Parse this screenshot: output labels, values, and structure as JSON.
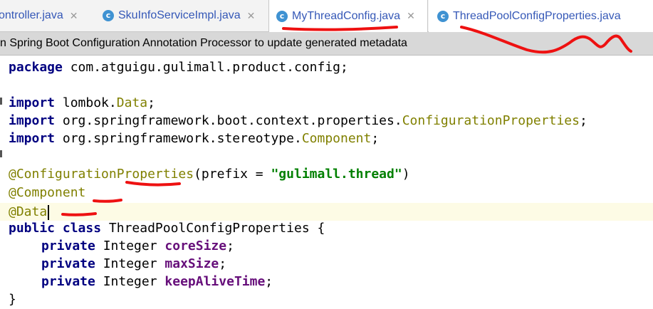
{
  "tabs": [
    {
      "label": "ontroller.java",
      "icon": "java-class-icon",
      "active": false
    },
    {
      "label": "SkuInfoServiceImpl.java",
      "icon": "java-class-icon",
      "active": false
    },
    {
      "label": "MyThreadConfig.java",
      "icon": "java-class-icon",
      "active": true
    },
    {
      "label": "ThreadPoolConfigProperties.java",
      "icon": "java-class-icon",
      "active": false
    }
  ],
  "notification": {
    "text": "n Spring Boot Configuration Annotation Processor to update generated metadata"
  },
  "code": {
    "line1": {
      "kw": "package",
      "rest": " com.atguigu.gulimall.product.config;"
    },
    "line3": {
      "kw": "import",
      "mid": " lombok.",
      "cls": "Data",
      "end": ";"
    },
    "line4": {
      "kw": "import",
      "mid": " org.springframework.boot.context.properties.",
      "cls": "ConfigurationProperties",
      "end": ";"
    },
    "line5": {
      "kw": "import",
      "mid": " org.springframework.stereotype.",
      "cls": "Component",
      "end": ";"
    },
    "line7": {
      "ann": "@ConfigurationProperties",
      "open": "(prefix = ",
      "str": "\"gulimall.thread\"",
      "close": ")"
    },
    "line8": {
      "ann": "@Component"
    },
    "line9": {
      "ann": "@Data"
    },
    "line10": {
      "kw1": "public",
      "kw2": "class",
      "name": " ThreadPoolConfigProperties {"
    },
    "fields": [
      {
        "kw": "private",
        "type": " Integer ",
        "name": "coreSize",
        "end": ";"
      },
      {
        "kw": "private",
        "type": " Integer ",
        "name": "maxSize",
        "end": ";"
      },
      {
        "kw": "private",
        "type": " Integer ",
        "name": "keepAliveTime",
        "end": ";"
      }
    ],
    "closing": "}"
  },
  "colors": {
    "keyword": "#000080",
    "annotation": "#808000",
    "string": "#008000",
    "field": "#660e7a",
    "tab_text": "#3558b7",
    "marker": "#ee1111"
  }
}
